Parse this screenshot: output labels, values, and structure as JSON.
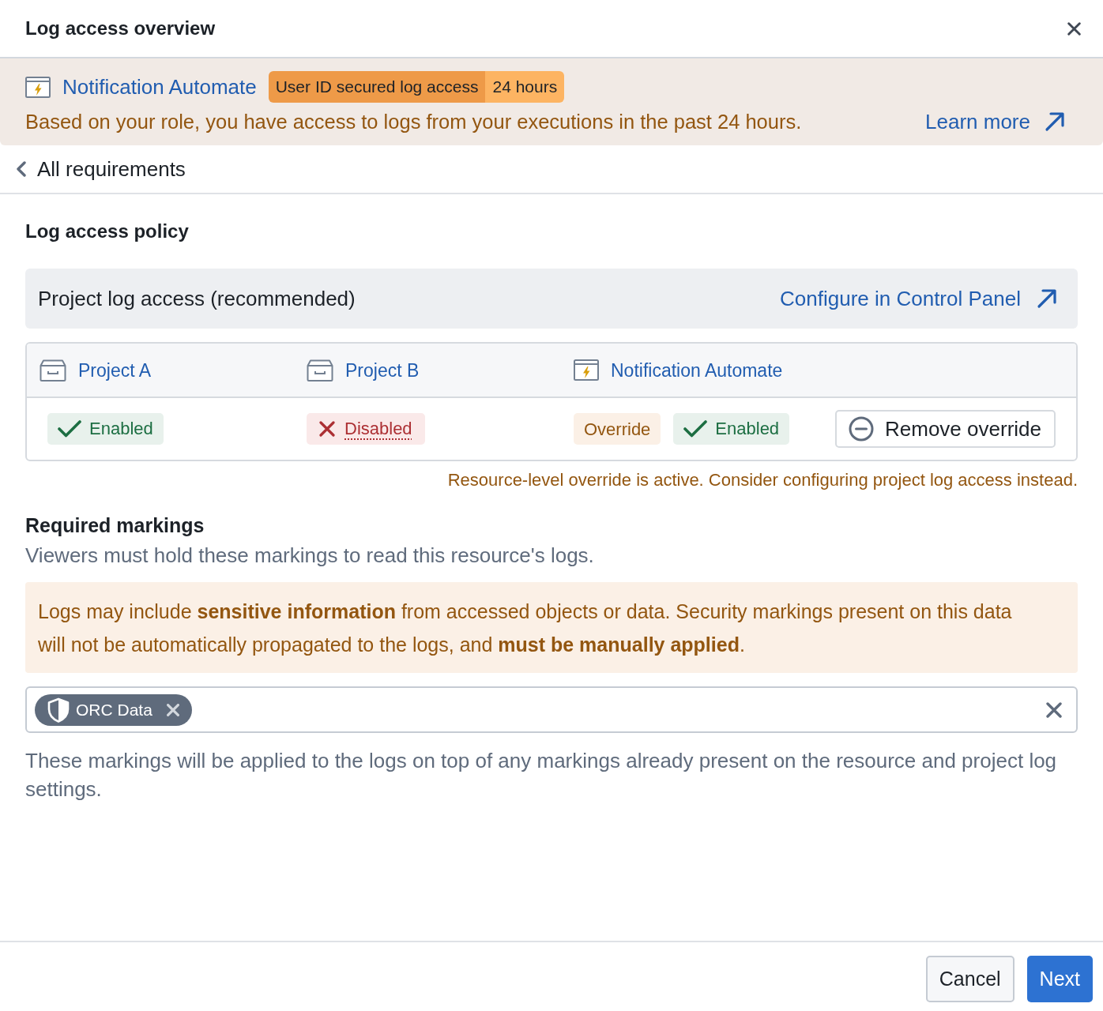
{
  "dialog": {
    "title": "Log access overview"
  },
  "banner": {
    "resource": "Notification Automate",
    "tag": {
      "label": "User ID secured log access",
      "value": "24 hours"
    },
    "message": "Based on your role, you have access to logs from your executions in the past 24 hours.",
    "link": "Learn more"
  },
  "back_link": "All requirements",
  "policy": {
    "heading": "Log access policy",
    "mode": {
      "label": "Project log access (recommended)",
      "link": "Configure in Control Panel"
    },
    "columns": [
      {
        "kind": "project",
        "name": "Project A",
        "tags": [
          {
            "kind": "status",
            "label": "Enabled",
            "enabled": true
          }
        ]
      },
      {
        "kind": "project",
        "name": "Project B",
        "tags": [
          {
            "kind": "status",
            "label": "Disabled",
            "enabled": false
          }
        ]
      },
      {
        "kind": "resource",
        "name": "Notification Automate",
        "tags": [
          {
            "kind": "override",
            "label": "Override"
          },
          {
            "kind": "status",
            "label": "Enabled",
            "enabled": true
          }
        ],
        "action": "Remove override"
      }
    ],
    "warning": "Resource-level override is active. Consider configuring project log access instead."
  },
  "markings": {
    "heading": "Required markings",
    "description": "Viewers must hold these markings to read this resource's logs.",
    "callout": "Logs may include **sensitive information** from accessed objects or data. Security markings present on this data will not be automatically propagated to the logs, and **must be manually applied**.",
    "tags": [
      {
        "label": "ORC Data"
      }
    ],
    "helper": "These markings will be applied to the logs on top of any markings already present on the resource and project log settings."
  },
  "footer": {
    "buttons": [
      {
        "kind": "default",
        "label": "Cancel"
      },
      {
        "kind": "primary",
        "label": "Next"
      }
    ]
  }
}
